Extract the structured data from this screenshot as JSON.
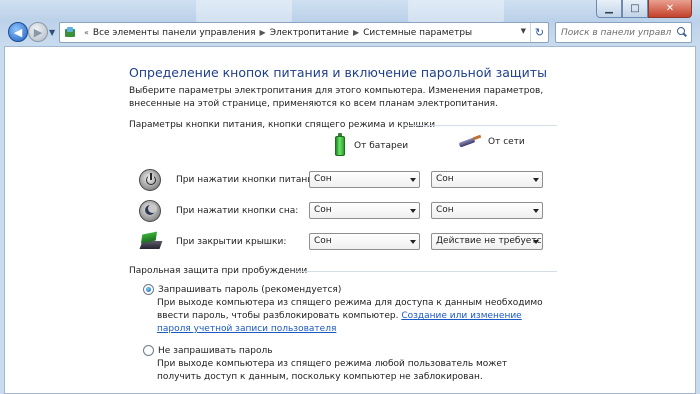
{
  "address": {
    "crumbs": [
      "Все элементы панели управления",
      "Электропитание",
      "Системные параметры"
    ]
  },
  "search": {
    "placeholder": "Поиск в панели управления"
  },
  "page": {
    "title": "Определение кнопок питания и включение парольной защиты",
    "intro": "Выберите параметры электропитания для этого компьютера. Изменения параметров, внесенные на этой странице, применяются ко всем планам электропитания."
  },
  "buttons_section": {
    "heading": "Параметры кнопки питания, кнопки спящего режима и крышки",
    "col_battery": "От батареи",
    "col_ac": "От сети",
    "rows": [
      {
        "label": "При нажатии кнопки питания:",
        "battery": "Сон",
        "ac": "Сон"
      },
      {
        "label": "При нажатии кнопки сна:",
        "battery": "Сон",
        "ac": "Сон"
      },
      {
        "label": "При закрытии крышки:",
        "battery": "Сон",
        "ac": "Действие не требуется"
      }
    ]
  },
  "password_section": {
    "heading": "Парольная защита при пробуждении",
    "option1_label": "Запрашивать пароль (рекомендуется)",
    "option1_desc": "При выходе компьютера из спящего режима для доступа к данным необходимо ввести пароль, чтобы разблокировать компьютер.",
    "option1_link": "Создание или изменение пароля учетной записи пользователя",
    "option2_label": "Не запрашивать пароль",
    "option2_desc": "При выходе компьютера из спящего режима любой пользователь может получить доступ к данным, поскольку компьютер не заблокирован."
  }
}
